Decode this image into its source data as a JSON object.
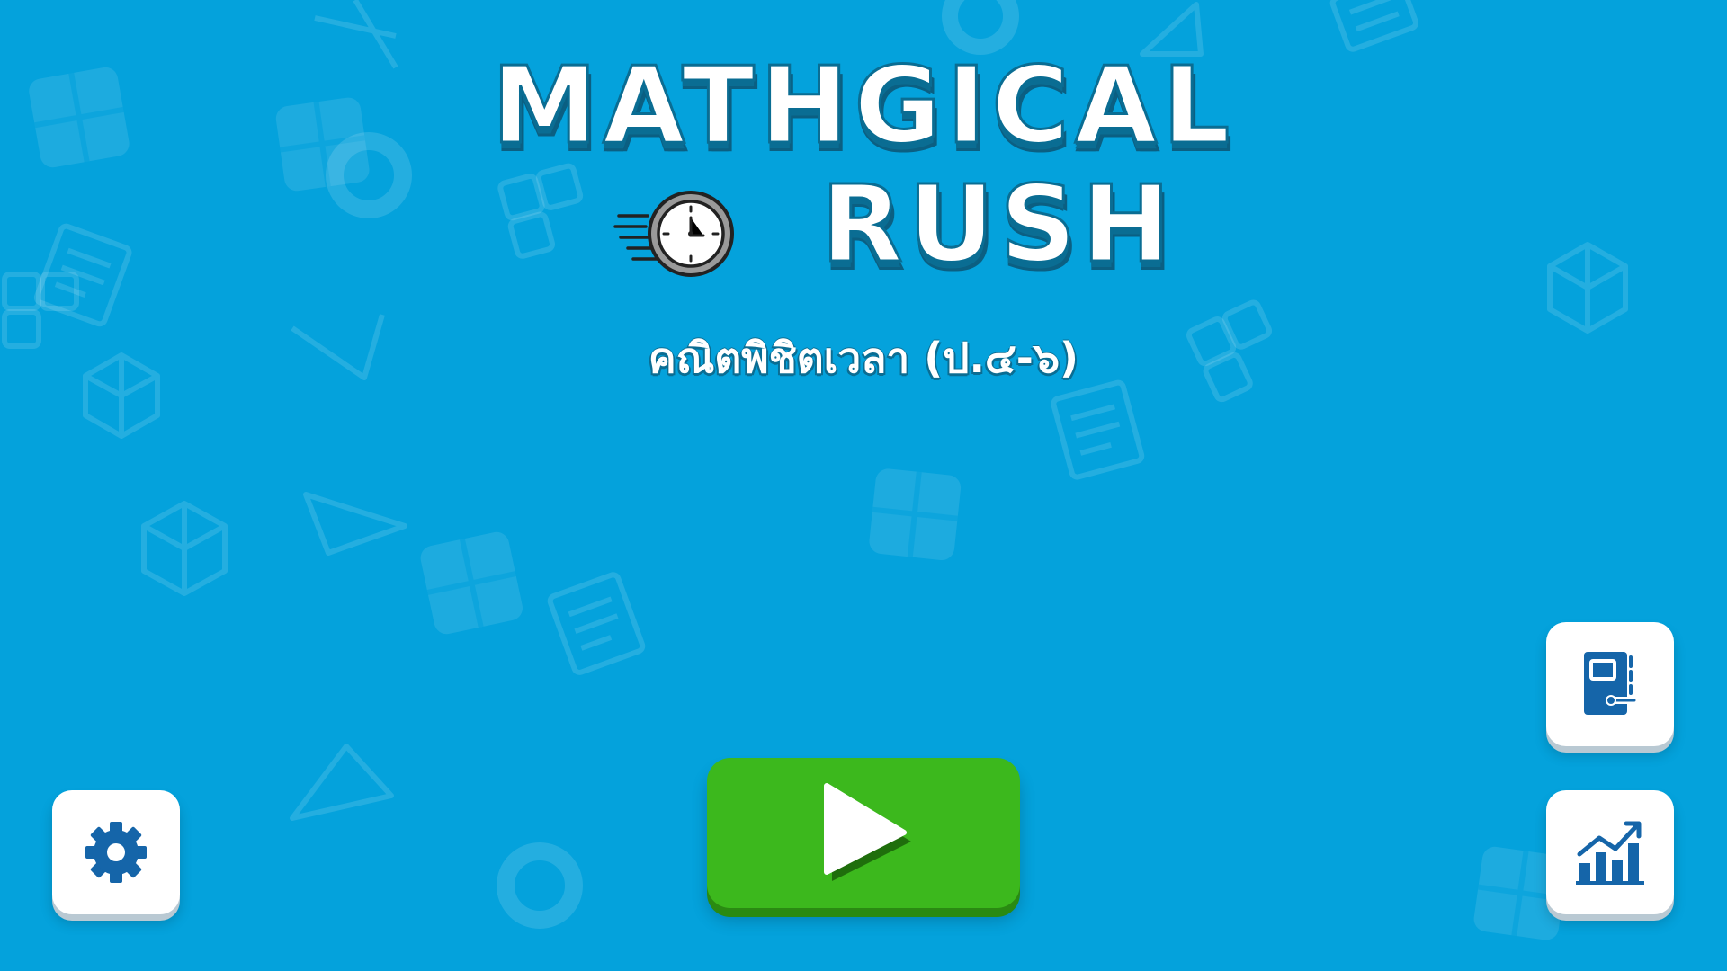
{
  "title": {
    "line1": "MATHGICAL",
    "line2": "RUSH",
    "subtitle": "คณิตพิชิตเวลา (ป.๔-๖)"
  },
  "icons": {
    "logo_clock": "stopwatch-icon",
    "play": "play-icon",
    "settings": "gear-icon",
    "book": "book-icon",
    "stats": "chart-icon"
  },
  "colors": {
    "background": "#04a2dc",
    "title_outline": "#0a6d93",
    "play_button": "#3cb81d",
    "icon_blue": "#1565a9"
  }
}
